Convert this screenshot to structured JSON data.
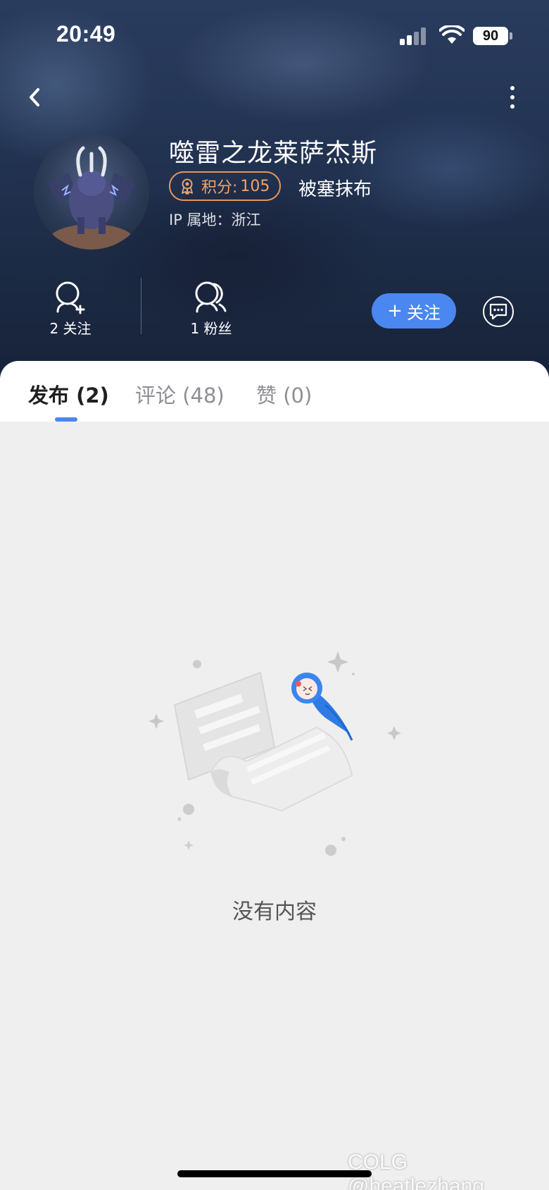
{
  "status_bar": {
    "time": "20:49",
    "battery": "90"
  },
  "profile": {
    "username": "噬雷之龙莱萨杰斯",
    "points_label": "积分:",
    "points_value": "105",
    "title": "被塞抹布",
    "ip_location": "IP 属地：浙江"
  },
  "stats": {
    "following_label": "2 关注",
    "followers_label": "1 粉丝"
  },
  "actions": {
    "follow_plus": "+",
    "follow_label": "关注"
  },
  "tabs": [
    {
      "label": "发布 (2)",
      "active": true
    },
    {
      "label": "评论 (48)",
      "active": false
    },
    {
      "label": "赞 (0)",
      "active": false
    }
  ],
  "empty_state": {
    "message": "没有内容"
  },
  "watermark": "COLG @heatlezhang",
  "colors": {
    "accent": "#4a87f0",
    "points_badge": "#e9955a",
    "header_bg": "#223352",
    "page_bg": "#efefef"
  },
  "icons": {
    "back": "chevron-left-icon",
    "more": "more-vertical-icon",
    "follow": "user-add-icon",
    "fans": "users-icon",
    "message": "chat-bubble-icon",
    "medal": "medal-icon"
  }
}
